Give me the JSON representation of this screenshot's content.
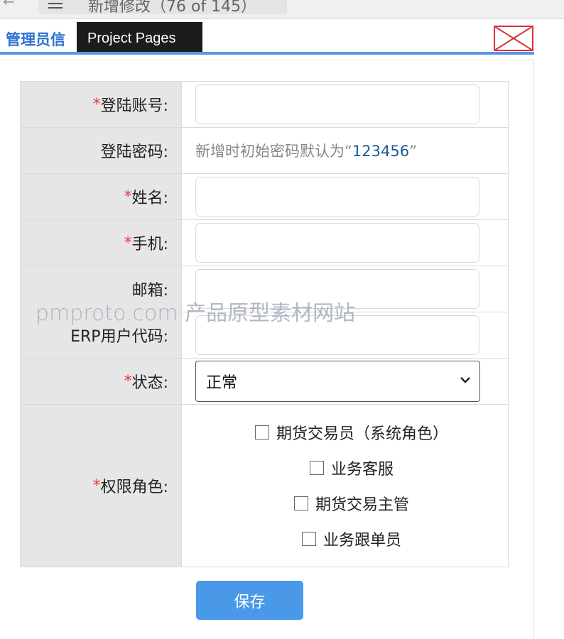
{
  "topbar": {
    "page_name": "新增修改（76 of 145）"
  },
  "section": {
    "title": "管理员信"
  },
  "tooltip": {
    "text": "Project Pages"
  },
  "form": {
    "account": {
      "label": "登陆账号:",
      "required_mark": "*",
      "value": ""
    },
    "password": {
      "label": "登陆密码:",
      "hint_prefix": "新增时初始密码默认为“",
      "hint_value": "123456",
      "hint_suffix": "”"
    },
    "name": {
      "label": "姓名:",
      "required_mark": "*",
      "value": ""
    },
    "phone": {
      "label": "手机:",
      "required_mark": "*",
      "value": ""
    },
    "email": {
      "label": "邮箱:",
      "value": ""
    },
    "erp": {
      "label": "ERP用户代码:",
      "value": ""
    },
    "status": {
      "label": "状态:",
      "required_mark": "*",
      "selected": "正常"
    },
    "roles": {
      "label": "权限角色:",
      "required_mark": "*",
      "options": [
        {
          "label": "期货交易员（系统角色）",
          "checked": false
        },
        {
          "label": "业务客服",
          "checked": false
        },
        {
          "label": "期货交易主管",
          "checked": false
        },
        {
          "label": "业务跟单员",
          "checked": false
        }
      ]
    }
  },
  "buttons": {
    "save": "保存"
  },
  "watermark": {
    "text": "pmproto.com 产品原型素材网站"
  },
  "colors": {
    "accent": "#2c6fd1",
    "required": "#e53935",
    "button": "#4a98e8"
  }
}
